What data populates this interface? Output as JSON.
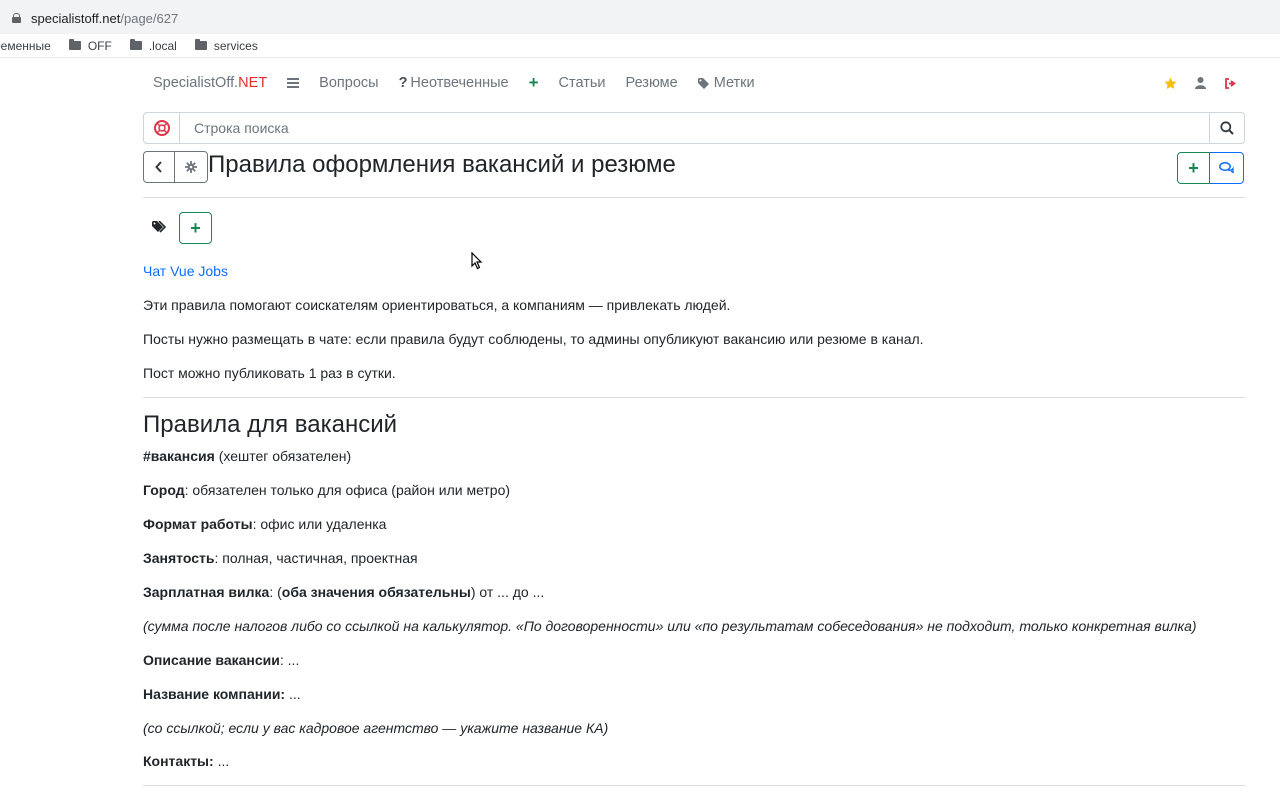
{
  "browser": {
    "url_host": "specialistoff.net",
    "url_path": "/page/627",
    "bookmarks": [
      "ременные",
      "OFF",
      ".local",
      "services"
    ]
  },
  "nav": {
    "brand_main": "SpecialistOff.",
    "brand_accent": "NET",
    "questions": "Вопросы",
    "unanswered": "Неотвеченные",
    "articles": "Статьи",
    "resume": "Резюме",
    "tags": "Метки"
  },
  "search": {
    "placeholder": "Строка поиска"
  },
  "page": {
    "title": "Правила оформления вакансий и резюме",
    "chat_link": "Чат Vue Jobs",
    "intro": [
      "Эти правила помогают соискателям ориентироваться, а компаниям — привлекать людей.",
      "Посты нужно размещать в чате: если правила будут соблюдены, то админы опубликуют вакансию или резюме в канал.",
      "Пост можно публиковать 1 раз в сутки."
    ],
    "section_title": "Правила для вакансий",
    "rules": {
      "hashtag_b": "#вакансия",
      "hashtag_rest": " (хештег обязателен)",
      "city_b": "Город",
      "city_rest": ": обязателен только для офиса (район или метро)",
      "format_b": "Формат работы",
      "format_rest": ": офис или удаленка",
      "employment_b": "Занятость",
      "employment_rest": ": полная, частичная, проектная",
      "salary_b": "Зарплатная вилка",
      "salary_mid": ": (",
      "salary_b2": "оба значения обязательны",
      "salary_rest": ") от ... до ...",
      "salary_note": "(сумма после налогов либо со ссылкой на калькулятор. «По договоренности» или «по результатам собеседования» не подходит, только конкретная вилка)",
      "desc_b": "Описание вакансии",
      "desc_rest": ": ...",
      "company_b": "Название компании:",
      "company_rest": " ...",
      "company_note": "(со ссылкой; если у вас кадровое агентство — укажите название КА)",
      "contacts_b": "Контакты:",
      "contacts_rest": " ..."
    }
  },
  "colors": {
    "brand_accent": "#e0302c",
    "green": "#198754",
    "blue": "#0d6efd",
    "star": "#f5c000",
    "logout": "#dc3545"
  },
  "icons": [
    "lock-icon",
    "folder-icon",
    "menu-icon",
    "question-icon",
    "plus-icon",
    "tag-icon",
    "star-icon",
    "user-icon",
    "logout-icon",
    "lifebuoy-icon",
    "search-icon",
    "chevron-left-icon",
    "gear-icon",
    "comments-icon",
    "tags-icon"
  ]
}
